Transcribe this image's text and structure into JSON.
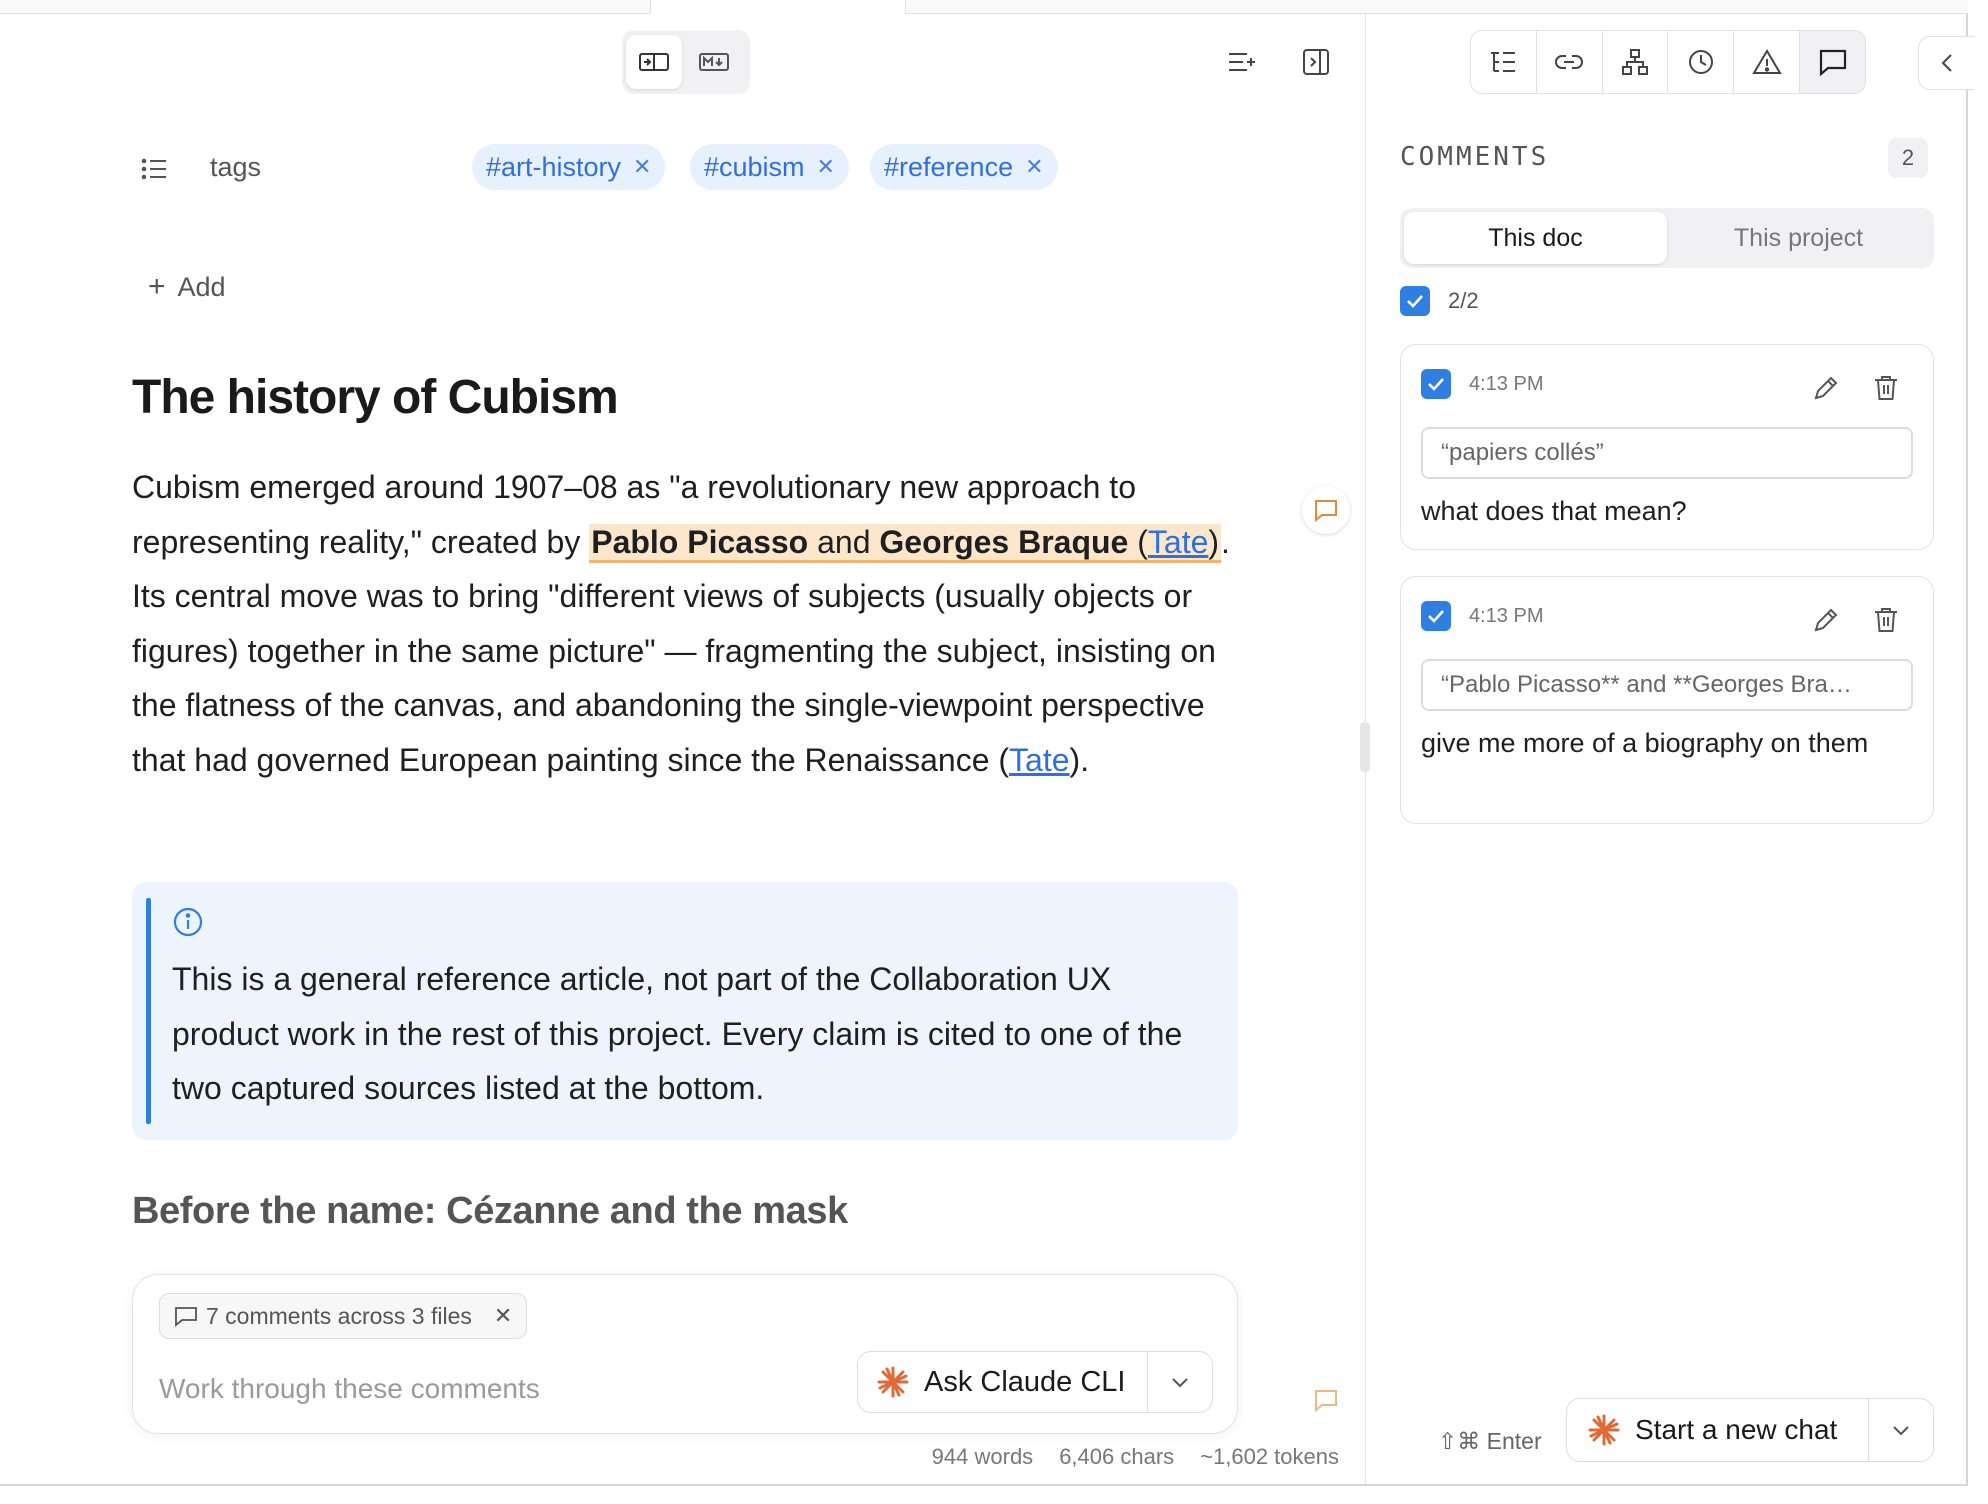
{
  "editor": {
    "tags_label": "tags",
    "tags": [
      "#art-history",
      "#cubism",
      "#reference"
    ],
    "add_label": "Add",
    "title": "The history of Cubism",
    "para": {
      "p1": "Cubism emerged around 1907–08 as \"a revolutionary new approach to representing reality,\" created by ",
      "h_name1": "Pablo Picasso",
      "h_and": " and ",
      "h_name2": "Georges Braque",
      "h_paren_open": " (",
      "link1": "Tate",
      "h_paren_close": ")",
      "p2": ". Its central move was to bring \"different views of subjects (usually objects or figures) together in the same picture\" — fragmenting the subject, insisting on the flatness of the canvas, and abandoning the single-viewpoint perspective that had governed European painting since the Renaissance (",
      "link2": "Tate",
      "p3": ")."
    },
    "callout_text": "This is a general reference article, not part of the Collaboration UX product work in the rest of this project. Every claim is cited to one of the two captured sources listed at the bottom.",
    "subheading": "Before the name: Cézanne and the mask",
    "chat": {
      "chip_label": "7 comments across 3 files",
      "placeholder": "Work through these comments",
      "ask_label": "Ask Claude CLI"
    },
    "status": {
      "words": "944 words",
      "chars": "6,406 chars",
      "tokens": "~1,602 tokens"
    }
  },
  "panel": {
    "heading": "COMMENTS",
    "count": "2",
    "scope_tabs": [
      "This doc",
      "This project"
    ],
    "resolved_summary": "2/2",
    "comments": [
      {
        "time": "4:13 PM",
        "quote": "“papiers collés”",
        "note": "what does that mean?"
      },
      {
        "time": "4:13 PM",
        "quote": "“Pablo Picasso** and **Georges Bra…",
        "note": "give me more of a biography on them"
      }
    ],
    "shortcut_hint": "⇧⌘ Enter",
    "new_chat_label": "Start a new chat"
  },
  "colors": {
    "accent": "#2f7fe0",
    "highlight": "#fde7cc",
    "highlight_underline": "#f4b46a",
    "tag_bg": "#e7f0fd",
    "callout_bg": "#eef4fd",
    "claude_orange": "#e0693a"
  },
  "icons": [
    "split-view-icon",
    "markdown-icon",
    "outline-add-icon",
    "panel-toggle-icon",
    "list-icon",
    "comment-bubble-icon",
    "info-icon",
    "outline-icon",
    "link-icon",
    "graph-icon",
    "history-icon",
    "warning-icon",
    "comments-icon",
    "chevron-left-icon",
    "check-icon",
    "pencil-icon",
    "trash-icon",
    "claude-sparkle-icon",
    "chevron-down-icon"
  ]
}
